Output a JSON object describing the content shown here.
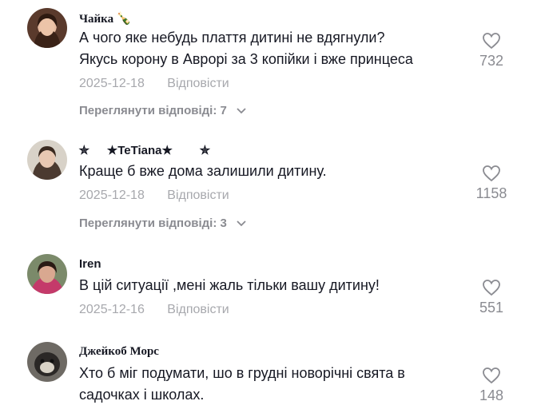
{
  "comments": [
    {
      "username": "Чайка",
      "emoji": "🍾",
      "text_lines": [
        "А чого яке небудь плаття дитині не вдягнули?",
        "Якусь корону в Аврорі за 3 копійки і вже принцеса"
      ],
      "date": "2025-12-18",
      "reply_label": "Відповісти",
      "likes": "732",
      "view_replies": "Переглянути відповіді: 7"
    },
    {
      "username": "★TeTiana★",
      "username_prefix": "✮",
      "username_suffix": "✮",
      "text_lines": [
        "Краще б вже дома залишили дитину."
      ],
      "date": "2025-12-18",
      "reply_label": "Відповісти",
      "likes": "1158",
      "view_replies": "Переглянути відповіді: 3"
    },
    {
      "username": "Iren",
      "text_lines": [
        "В цій ситуації ,мені жаль тільки вашу дитину!"
      ],
      "date": "2025-12-16",
      "reply_label": "Відповісти",
      "likes": "551"
    },
    {
      "username": "Джейкоб Морс",
      "text_lines": [
        "Хто б міг подумати, шо в грудні новорічні свята в",
        "садочках і школах."
      ],
      "likes": "148"
    }
  ],
  "colors": {
    "text": "#161823",
    "muted": "#a7a8ad",
    "count": "#8a8b91"
  },
  "icons": [
    "heart-outline-icon",
    "chevron-down-icon",
    "bottle-emoji-icon"
  ]
}
